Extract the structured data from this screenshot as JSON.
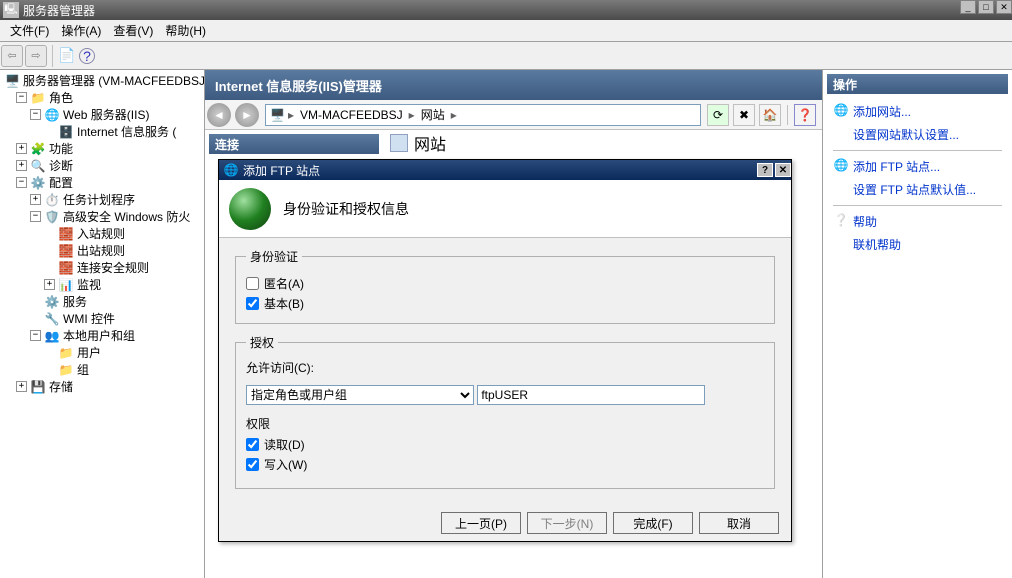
{
  "titlebar": {
    "title": "服务器管理器"
  },
  "menubar": [
    "文件(F)",
    "操作(A)",
    "查看(V)",
    "帮助(H)"
  ],
  "tree": {
    "root": "服务器管理器 (VM-MACFEEDBSJ)",
    "roles": "角色",
    "web": "Web 服务器(IIS)",
    "iis": "Internet 信息服务 (",
    "features": "功能",
    "diag": "诊断",
    "config": "配置",
    "task": "任务计划程序",
    "firewall": "高级安全 Windows 防火",
    "inbound": "入站规则",
    "outbound": "出站规则",
    "connsec": "连接安全规则",
    "monitor": "监视",
    "services": "服务",
    "wmi": "WMI 控件",
    "localusers": "本地用户和组",
    "users": "用户",
    "groups": "组",
    "storage": "存储"
  },
  "center": {
    "title": "Internet 信息服务(IIS)管理器",
    "breadcrumb": {
      "server": "VM-MACFEEDBSJ",
      "sites": "网站"
    },
    "conn_header": "连接",
    "behind_tab": "网站"
  },
  "actions": {
    "header": "操作",
    "add_site": "添加网站...",
    "set_site_defaults": "设置网站默认设置...",
    "add_ftp": "添加 FTP 站点...",
    "set_ftp_defaults": "设置 FTP 站点默认值...",
    "help": "帮助",
    "online_help": "联机帮助"
  },
  "dialog": {
    "title": "添加 FTP 站点",
    "header": "身份验证和授权信息",
    "auth_group": "身份验证",
    "anon": "匿名(A)",
    "basic": "基本(B)",
    "authz_group": "授权",
    "allow_access": "允许访问(C):",
    "access_option": "指定角色或用户组",
    "user_input": "ftpUSER",
    "perm_label": "权限",
    "read": "读取(D)",
    "write": "写入(W)",
    "prev": "上一页(P)",
    "next": "下一步(N)",
    "finish": "完成(F)",
    "cancel": "取消"
  }
}
